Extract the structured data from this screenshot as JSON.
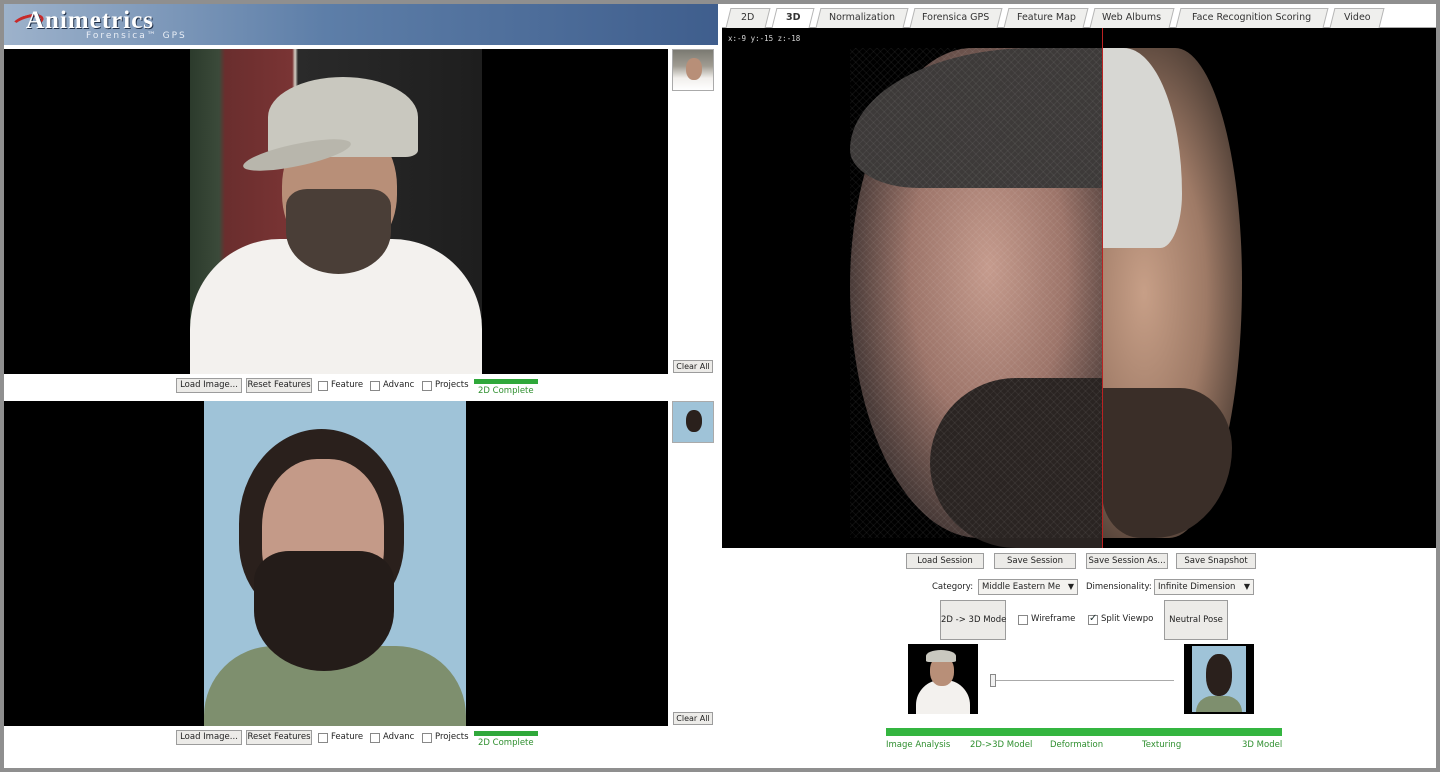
{
  "branding": {
    "logo_text": "Animetrics",
    "logo_subtitle": "Forensica™ GPS"
  },
  "left_panels": [
    {
      "clear_all_label": "Clear All",
      "load_image_label": "Load Image...",
      "reset_features_label": "Reset Features",
      "feature_label": "Feature",
      "feature_checked": false,
      "advanced_label": "Advanc",
      "advanced_checked": false,
      "projects_label": "Projects",
      "projects_checked": false,
      "progress_label": "2D Complete",
      "progress_fraction": 1.0
    },
    {
      "clear_all_label": "Clear All",
      "load_image_label": "Load Image...",
      "reset_features_label": "Reset Features",
      "feature_label": "Feature",
      "feature_checked": false,
      "advanced_label": "Advanc",
      "advanced_checked": false,
      "projects_label": "Projects",
      "projects_checked": false,
      "progress_label": "2D Complete",
      "progress_fraction": 1.0
    }
  ],
  "tabs": [
    {
      "label": "2D",
      "active": false
    },
    {
      "label": "3D",
      "active": true
    },
    {
      "label": "Normalization",
      "active": false
    },
    {
      "label": "Forensica GPS",
      "active": false
    },
    {
      "label": "Feature Map",
      "active": false
    },
    {
      "label": "Web Albums",
      "active": false
    },
    {
      "label": "Face Recognition Scoring",
      "active": false
    },
    {
      "label": "Video",
      "active": false
    }
  ],
  "viewer3d": {
    "coord_readout": "x:-9  y:-15  z:-18"
  },
  "session_buttons": {
    "load": "Load Session",
    "save": "Save Session",
    "save_as": "Save Session As...",
    "snapshot": "Save Snapshot"
  },
  "selectors": {
    "category_label": "Category:",
    "category_value": "Middle Eastern Me",
    "dimensionality_label": "Dimensionality:",
    "dimensionality_value": "Infinite Dimension"
  },
  "mode_controls": {
    "convert_button": "2D -> 3D Mode",
    "wireframe_label": "Wireframe",
    "wireframe_checked": false,
    "split_view_label": "Split Viewpo",
    "split_view_checked": true,
    "neutral_pose_button": "Neutral Pose"
  },
  "morph": {
    "slider_position": 0.0
  },
  "pipeline": {
    "progress_fraction": 1.0,
    "stages": [
      "Image Analysis",
      "2D->3D Model",
      "Deformation",
      "Texturing",
      "3D Model"
    ]
  },
  "colors": {
    "progress_green": "#34b540",
    "split_line": "#bb2222",
    "header_blue": "#3f5e8d"
  }
}
